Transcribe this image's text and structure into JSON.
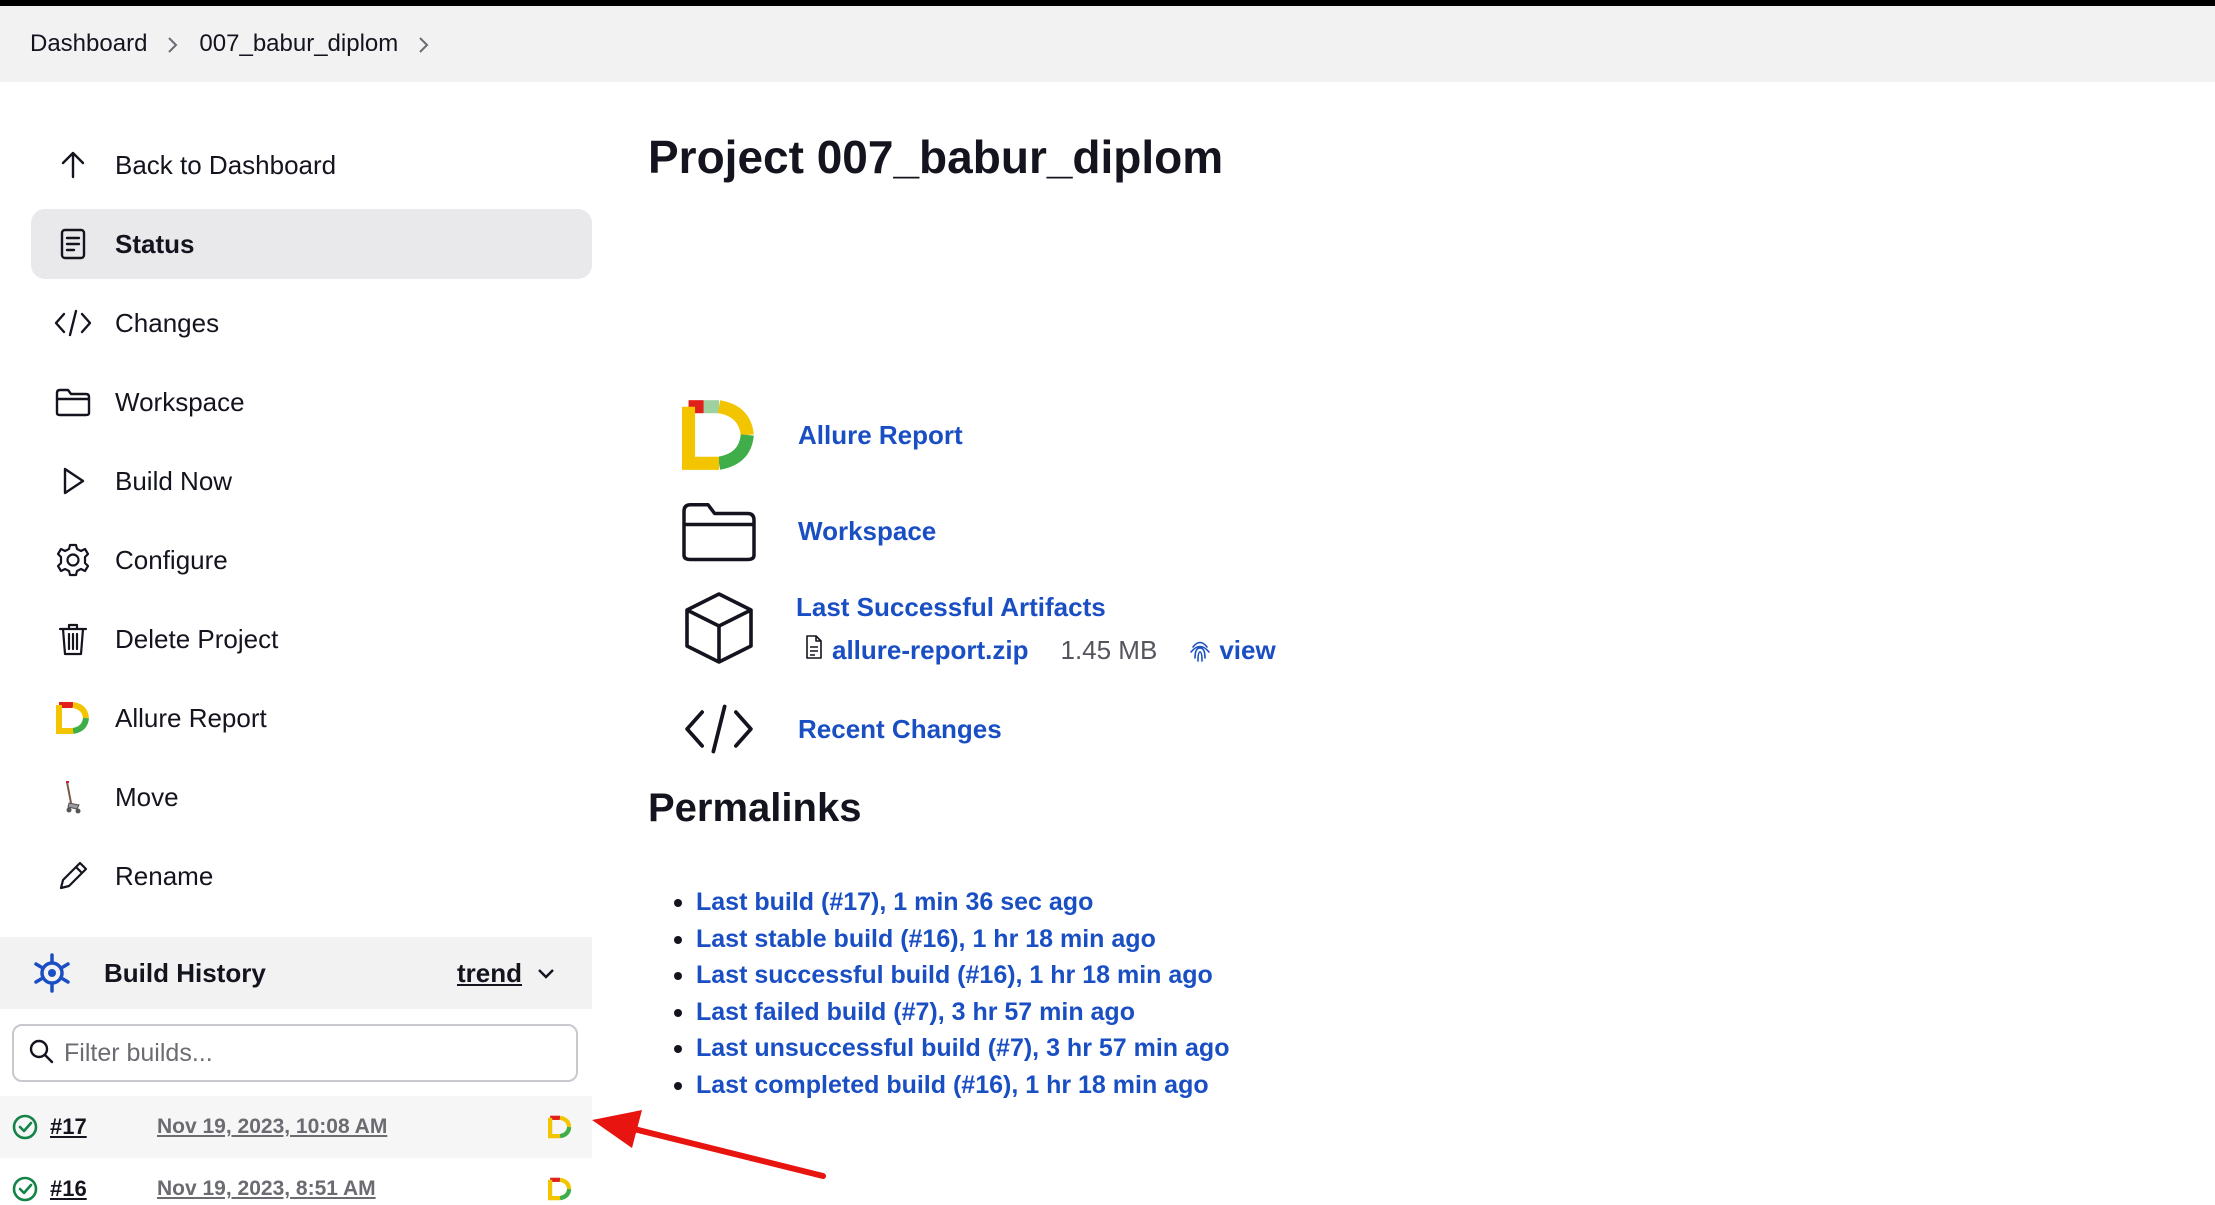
{
  "breadcrumb": {
    "items": [
      "Dashboard",
      "007_babur_diplom"
    ]
  },
  "sidebar": {
    "items": [
      {
        "label": "Back to Dashboard",
        "icon": "arrow-up-icon"
      },
      {
        "label": "Status",
        "icon": "document-icon"
      },
      {
        "label": "Changes",
        "icon": "code-icon"
      },
      {
        "label": "Workspace",
        "icon": "folder-icon"
      },
      {
        "label": "Build Now",
        "icon": "play-icon"
      },
      {
        "label": "Configure",
        "icon": "gear-icon"
      },
      {
        "label": "Delete Project",
        "icon": "trash-icon"
      },
      {
        "label": "Allure Report",
        "icon": "allure-icon"
      },
      {
        "label": "Move",
        "icon": "move-icon"
      },
      {
        "label": "Rename",
        "icon": "pencil-icon"
      }
    ],
    "active_index": 1
  },
  "build_history": {
    "title": "Build History",
    "trend_label": "trend",
    "filter_placeholder": "Filter builds...",
    "builds": [
      {
        "number": "#17",
        "date": "Nov 19, 2023, 10:08 AM",
        "status": "success"
      },
      {
        "number": "#16",
        "date": "Nov 19, 2023, 8:51 AM",
        "status": "success"
      }
    ]
  },
  "main": {
    "title": "Project 007_babur_diplom",
    "links": {
      "allure": "Allure Report",
      "workspace": "Workspace",
      "artifacts": "Last Successful Artifacts",
      "recent_changes": "Recent Changes"
    },
    "artifact": {
      "file": "allure-report.zip",
      "size": "1.45 MB",
      "view": "view"
    },
    "permalinks_title": "Permalinks",
    "permalinks": [
      "Last build (#17), 1 min 36 sec ago",
      "Last stable build (#16), 1 hr 18 min ago",
      "Last successful build (#16), 1 hr 18 min ago",
      "Last failed build (#7), 3 hr 57 min ago",
      "Last unsuccessful build (#7), 3 hr 57 min ago",
      "Last completed build (#16), 1 hr 18 min ago"
    ]
  },
  "colors": {
    "link": "#1a4fc4",
    "success": "#138347",
    "annotation_arrow": "#e8140f"
  }
}
